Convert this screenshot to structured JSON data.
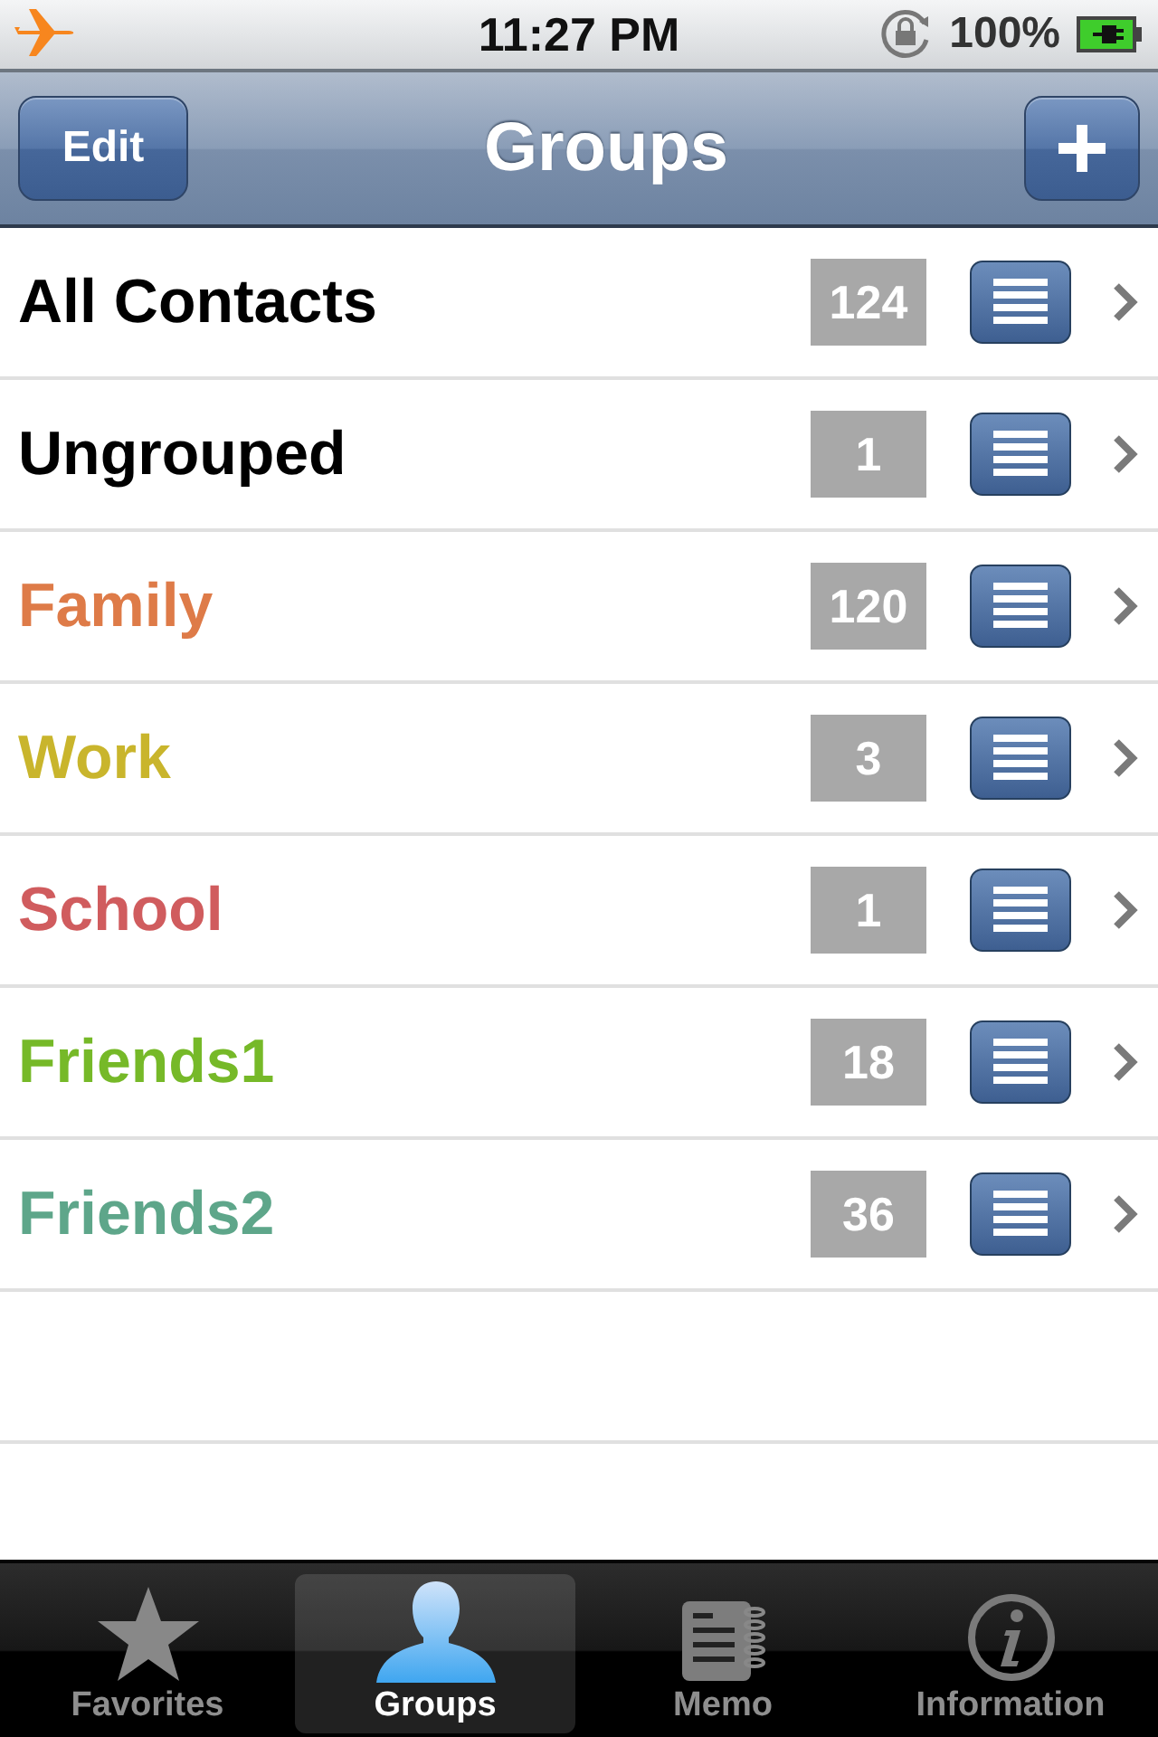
{
  "status_bar": {
    "time": "11:27 PM",
    "battery": "100%"
  },
  "nav_bar": {
    "title": "Groups",
    "left_button": "Edit"
  },
  "groups": [
    {
      "name": "All Contacts",
      "count": "124",
      "color": "#000000"
    },
    {
      "name": "Ungrouped",
      "count": "1",
      "color": "#000000"
    },
    {
      "name": "Family",
      "count": "120",
      "color": "#de7b48"
    },
    {
      "name": "Work",
      "count": "3",
      "color": "#c9b52c"
    },
    {
      "name": "School",
      "count": "1",
      "color": "#d05c5e"
    },
    {
      "name": "Friends1",
      "count": "18",
      "color": "#76b928"
    },
    {
      "name": "Friends2",
      "count": "36",
      "color": "#5ea68a"
    }
  ],
  "tab_bar": [
    {
      "label": "Favorites",
      "kind": "star",
      "selected": false
    },
    {
      "label": "Groups",
      "kind": "person",
      "selected": true
    },
    {
      "label": "Memo",
      "kind": "notebook",
      "selected": false
    },
    {
      "label": "Information",
      "kind": "info",
      "selected": false
    }
  ]
}
